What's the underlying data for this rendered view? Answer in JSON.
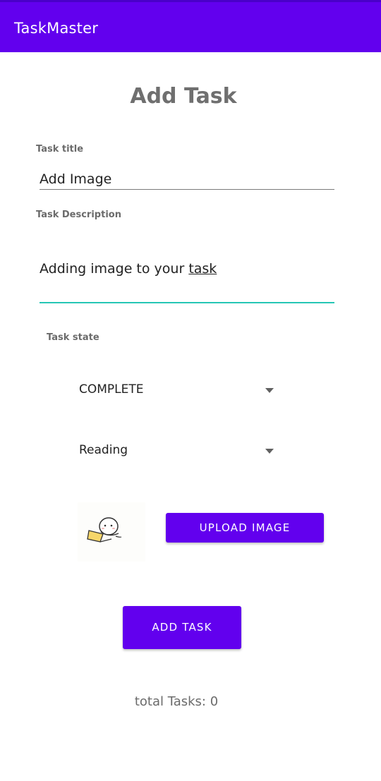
{
  "app_bar": {
    "title": "TaskMaster",
    "color": "#6200ee"
  },
  "form": {
    "heading": "Add Task",
    "title_field": {
      "label": "Task title",
      "value": "Add Image"
    },
    "description_field": {
      "label": "Task Description",
      "value_prefix": "Adding image to your ",
      "value_underlined": "task",
      "focus_color": "#26c6b5"
    },
    "state_label": "Task state",
    "spinners": [
      {
        "selected": "COMPLETE",
        "icon": "dropdown-arrow-icon"
      },
      {
        "selected": "Reading",
        "icon": "dropdown-arrow-icon"
      }
    ],
    "image_preview": {
      "icon": "character-with-laptop-sticker"
    },
    "upload_button_label": "UPLOAD IMAGE",
    "add_button_label": "ADD TASK"
  },
  "footer": {
    "total_tasks_text": "total Tasks: 0"
  }
}
